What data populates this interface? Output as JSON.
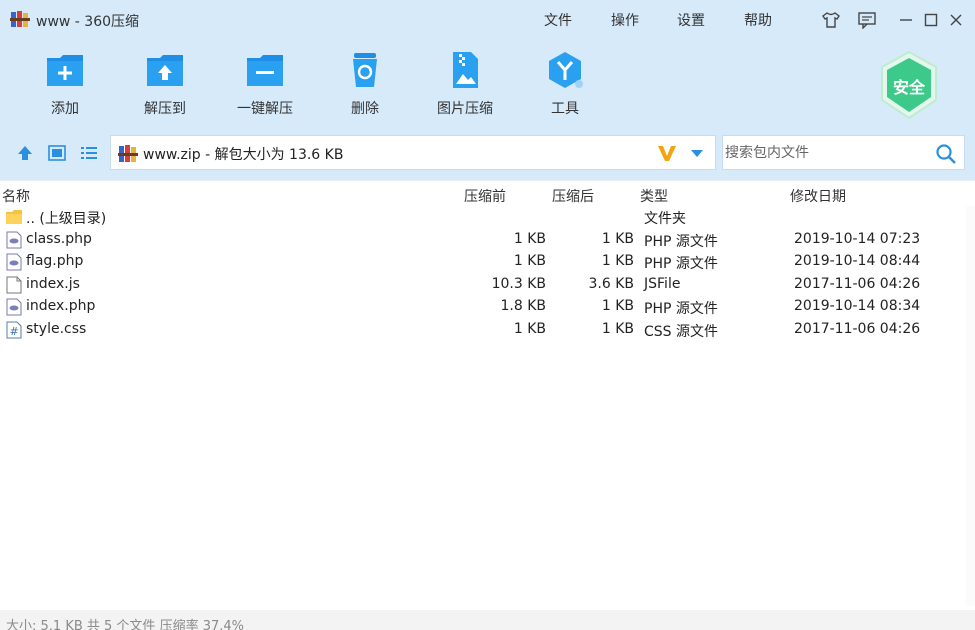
{
  "app": {
    "title": "www - 360压缩",
    "icon": "winrar-books-icon"
  },
  "menu": [
    "文件",
    "操作",
    "设置",
    "帮助"
  ],
  "toolbar": {
    "add_label": "添加",
    "extract_to_label": "解压到",
    "one_click_extract_label": "一键解压",
    "delete_label": "删除",
    "image_compress_label": "图片压缩",
    "tools_label": "工具"
  },
  "security_badge": "安全",
  "address": {
    "path": "www.zip - 解包大小为 13.6 KB"
  },
  "search": {
    "placeholder": "搜索包内文件"
  },
  "columns": {
    "name": "名称",
    "compressed": "压缩前",
    "original": "压缩后",
    "type": "类型",
    "modified": "修改日期"
  },
  "files": [
    {
      "name": ".. (上级目录)",
      "csize": "",
      "osize": "",
      "type": "文件夹",
      "date": "",
      "icon": "folder-icon"
    },
    {
      "name": "class.php",
      "csize": "1 KB",
      "osize": "1 KB",
      "type": "PHP 源文件",
      "date": "2019-10-14 07:23",
      "icon": "php-file-icon"
    },
    {
      "name": "flag.php",
      "csize": "1 KB",
      "osize": "1 KB",
      "type": "PHP 源文件",
      "date": "2019-10-14 08:44",
      "icon": "php-file-icon"
    },
    {
      "name": "index.js",
      "csize": "10.3 KB",
      "osize": "3.6 KB",
      "type": "JSFile",
      "date": "2017-11-06 04:26",
      "icon": "generic-file-icon"
    },
    {
      "name": "index.php",
      "csize": "1.8 KB",
      "osize": "1 KB",
      "type": "PHP 源文件",
      "date": "2019-10-14 08:34",
      "icon": "php-file-icon"
    },
    {
      "name": "style.css",
      "csize": "1 KB",
      "osize": "1 KB",
      "type": "CSS 源文件",
      "date": "2017-11-06 04:26",
      "icon": "css-file-icon"
    }
  ],
  "status": "大小: 5.1 KB 共 5 个文件 压缩率 37.4%",
  "colors": {
    "header_bg": "#d6eafa",
    "accent_blue": "#1e8ee6",
    "security_green": "#3cc98a"
  }
}
